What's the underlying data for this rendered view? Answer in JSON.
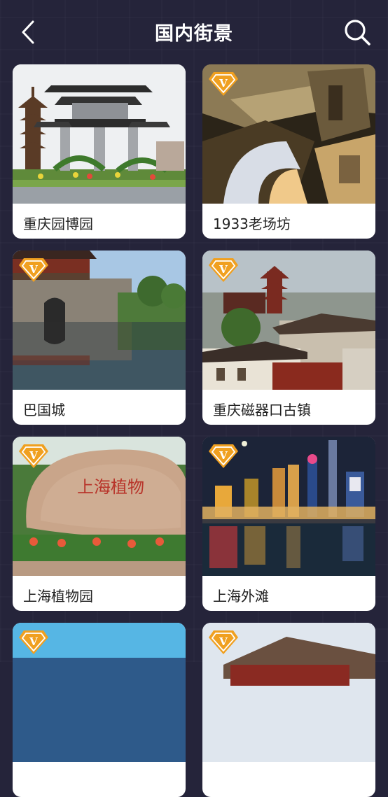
{
  "header": {
    "title": "国内街景"
  },
  "icons": {
    "back": "back-chevron-icon",
    "search": "search-icon",
    "vip": "vip-badge-icon"
  },
  "colors": {
    "background": "#25243a",
    "vip_badge": "#f0a020",
    "card": "#ffffff"
  },
  "cards": [
    {
      "label": "重庆园博园",
      "vip": false
    },
    {
      "label": "1933老场坊",
      "vip": true
    },
    {
      "label": "巴国城",
      "vip": true
    },
    {
      "label": "重庆磁器口古镇",
      "vip": true
    },
    {
      "label": "上海植物园",
      "vip": true
    },
    {
      "label": "上海外滩",
      "vip": true
    },
    {
      "label": "",
      "vip": true
    },
    {
      "label": "",
      "vip": true
    }
  ],
  "rock_inscription": "上海植物"
}
